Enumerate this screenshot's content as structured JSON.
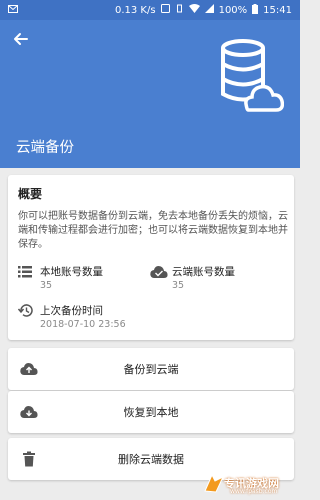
{
  "status_bar": {
    "network_speed": "0.13 K/s",
    "battery": "100%",
    "time": "15:41"
  },
  "header": {
    "title": "云端备份"
  },
  "overview": {
    "title": "概要",
    "description": "你可以把账号数据备份到云端，免去本地备份丢失的烦恼，云端和传输过程都会进行加密；也可以将云端数据恢复到本地并保存。",
    "local_count_label": "本地账号数量",
    "local_count_value": "35",
    "cloud_count_label": "云端账号数量",
    "cloud_count_value": "35",
    "last_backup_label": "上次备份时间",
    "last_backup_value": "2018-07-10 23:56"
  },
  "actions": {
    "backup_label": "备份到云端",
    "restore_label": "恢复到本地",
    "delete_label": "删除云端数据"
  },
  "watermark": {
    "text": "专讯游戏网",
    "url": "www.fpasb.com"
  },
  "colors": {
    "header": "#4a7fd0",
    "status_bar": "#3f72c4",
    "background": "#ececec"
  }
}
